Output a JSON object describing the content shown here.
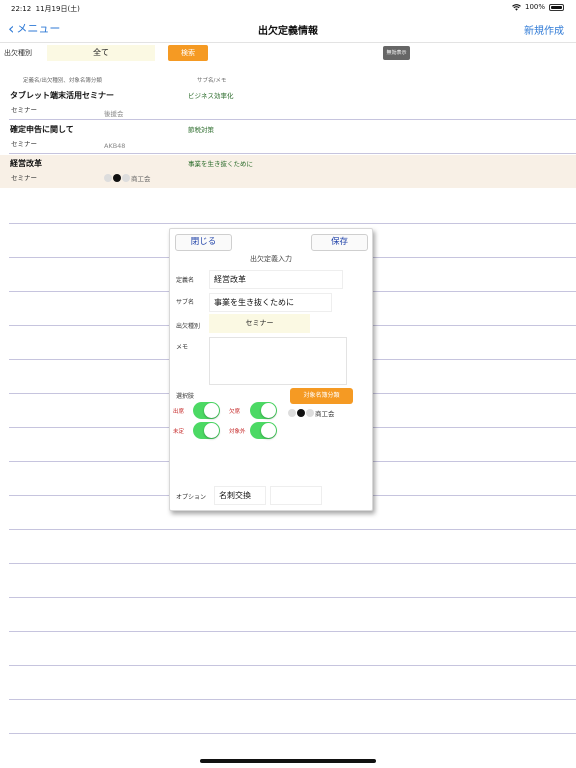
{
  "status": {
    "time": "22:12",
    "date": "11月19日(土)",
    "battery": "100%"
  },
  "nav": {
    "back_label": "メニュー",
    "title": "出欠定義情報",
    "new_label": "新規作成"
  },
  "filter": {
    "label": "出欠種別",
    "value": "全て",
    "search_label": "検索",
    "invalid_label": "無効表示"
  },
  "list_header": {
    "col1": "定義名/出欠種別、対象名簿分類",
    "col2": "サブ名/メモ"
  },
  "rows": [
    {
      "name": "タブレット端末活用セミナー",
      "kind": "セミナー",
      "target": "後援会",
      "sub": "ビジネス効率化"
    },
    {
      "name": "確定申告に関して",
      "kind": "セミナー",
      "target": "AKB48",
      "sub": "節税対策"
    },
    {
      "name": "経営改革",
      "kind": "セミナー",
      "target": "商工会",
      "sub": "事業を生き抜くために"
    }
  ],
  "modal": {
    "close_label": "閉じる",
    "save_label": "保存",
    "title": "出欠定義入力",
    "name_label": "定義名",
    "name_value": "経営改革",
    "sub_label": "サブ名",
    "sub_value": "事業を生き抜くために",
    "kind_label": "出欠種別",
    "kind_value": "セミナー",
    "memo_label": "メモ",
    "memo_value": "",
    "choices_label": "選択肢",
    "target_button_label": "対象名簿分類",
    "target_value": "商工会",
    "toggles": {
      "present": "出席",
      "absent": "欠席",
      "undecided": "未定",
      "excluded": "対象外"
    },
    "option_label": "オプション",
    "option_value": "名刺交換",
    "option_value2": ""
  },
  "colors": {
    "accent": "#2f7ad6",
    "orange": "#f59a23",
    "toggle_on": "#4cd964",
    "selected_row": "#f8f0e6"
  }
}
